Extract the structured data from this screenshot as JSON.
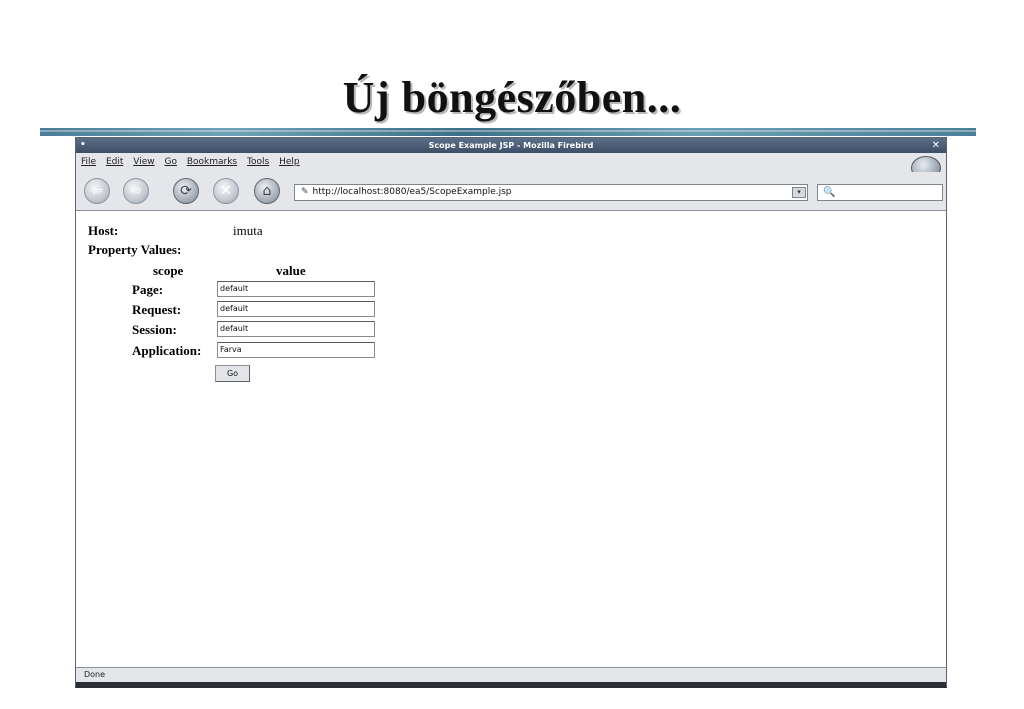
{
  "slide": {
    "title": "Új böngészőben..."
  },
  "window": {
    "title": "Scope Example JSP - Mozilla Firebird",
    "close_glyph": "✕",
    "menu_glyph": "•"
  },
  "menu": {
    "items": [
      "File",
      "Edit",
      "View",
      "Go",
      "Bookmarks",
      "Tools",
      "Help"
    ]
  },
  "toolbar": {
    "buttons": [
      {
        "name": "back-icon",
        "glyph": "⇦"
      },
      {
        "name": "forward-icon",
        "glyph": "⇨"
      },
      {
        "name": "reload-icon",
        "glyph": "⟳"
      },
      {
        "name": "stop-icon",
        "glyph": "✕"
      },
      {
        "name": "home-icon",
        "glyph": "⌂"
      }
    ],
    "url": "http://localhost:8080/ea5/ScopeExample.jsp",
    "url_icon": "✎",
    "search_icon": "🔍"
  },
  "page": {
    "host_label": "Host:",
    "host_value": "imuta",
    "property_values_label": "Property Values:",
    "col_scope": "scope",
    "col_value": "value",
    "rows": [
      {
        "label": "Page:",
        "value": "default"
      },
      {
        "label": "Request:",
        "value": "default"
      },
      {
        "label": "Session:",
        "value": "default"
      },
      {
        "label": "Application:",
        "value": "Farva"
      }
    ],
    "go_button": "Go"
  },
  "status": {
    "text": "Done"
  }
}
